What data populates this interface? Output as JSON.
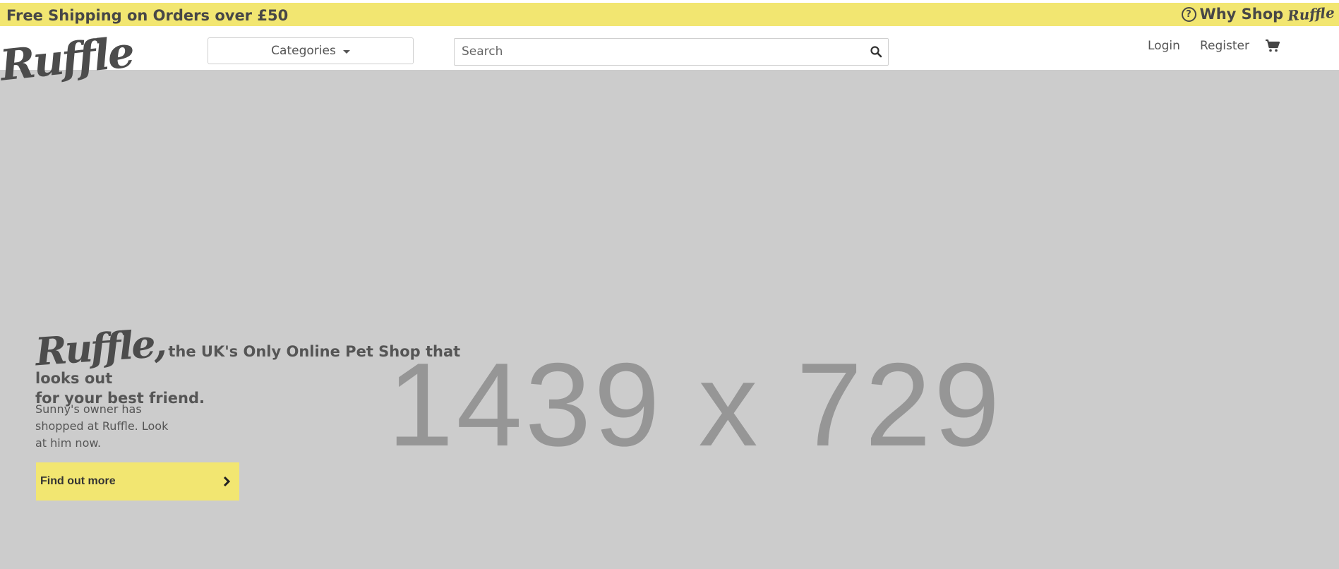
{
  "topbar": {
    "shipping_text": "Free Shipping on Orders over £50",
    "why_shop_text": "Why Shop",
    "why_shop_logo": "Ruffle"
  },
  "header": {
    "logo": "Ruffle",
    "categories_label": "Categories",
    "search_placeholder": "Search",
    "login_label": "Login",
    "register_label": "Register"
  },
  "hero": {
    "placeholder_text": "1439 x 729",
    "brand": "Ruffle,",
    "tagline_part1": "the UK's Only Online Pet Shop that looks out",
    "tagline_part2": "for your best friend.",
    "description": "Sunny's owner has shopped at Ruffle. Look at him now.",
    "cta_label": "Find out more"
  },
  "colors": {
    "accent_yellow": "#f2e671",
    "hero_bg": "#cccccc",
    "text_dark": "#555555"
  },
  "icons": [
    "question-circle-icon",
    "caret-down-icon",
    "search-icon",
    "shopping-cart-icon",
    "chevron-right-icon"
  ]
}
